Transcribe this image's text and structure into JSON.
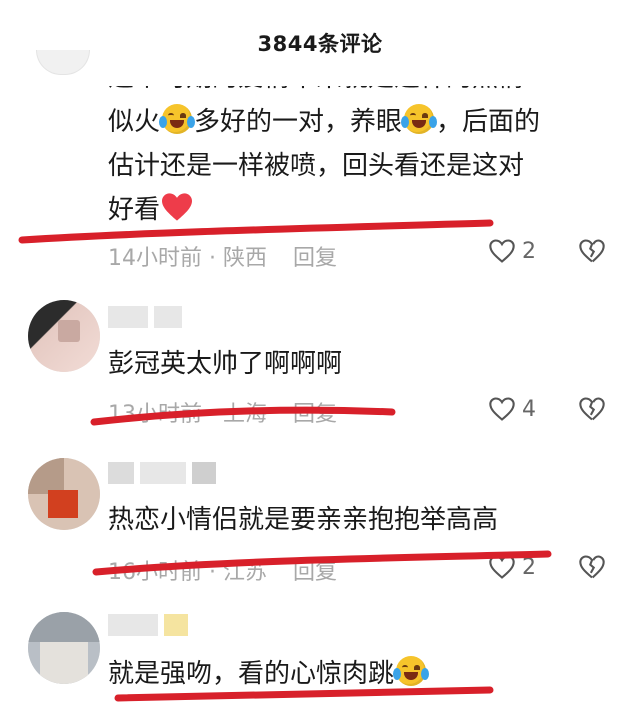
{
  "header": {
    "title": "3844条评论"
  },
  "comments": [
    {
      "lines": [
        "这个时期的爱情本来就是这样的热情",
        "似火",
        "多好的一对，养眼",
        "，后面的",
        "估计还是一样被喷，回头看还是这对",
        "好看"
      ],
      "time": "14小时前",
      "location": "陕西",
      "reply": "回复",
      "likes": "2",
      "emojis": [
        "laughing-tears-emoji",
        "laughing-tears-emoji",
        "red-heart-emoji"
      ]
    },
    {
      "text": "彭冠英太帅了啊啊啊",
      "time": "13小时前",
      "location": "上海",
      "reply": "回复",
      "likes": "4"
    },
    {
      "text": "热恋小情侣就是要亲亲抱抱举高高",
      "time": "16小时前",
      "location": "江苏",
      "reply": "回复",
      "likes": "2"
    },
    {
      "text": "就是强吻，看的心惊肉跳",
      "emojis": [
        "laughing-tears-emoji"
      ]
    }
  ],
  "separator": " · ",
  "colors": {
    "annotation_red": "#d8202a",
    "meta_gray": "#a8a8a8",
    "heart_red": "#ee3c4a"
  }
}
